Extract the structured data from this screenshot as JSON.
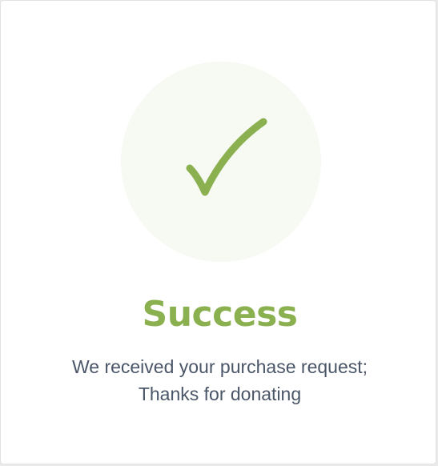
{
  "dialog": {
    "title": "Success",
    "message_line_1": "We received your purchase request;",
    "message_line_2": "Thanks for donating",
    "icon": "checkmark-icon"
  },
  "colors": {
    "accent": "#8bb050",
    "circle_background": "#f7f9f3",
    "text": "#4a5668"
  }
}
